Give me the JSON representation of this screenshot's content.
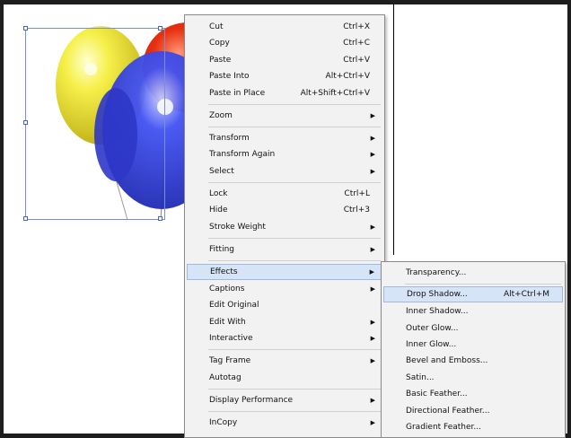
{
  "context_menu": {
    "items": [
      {
        "label": "Cut",
        "shortcut": "Ctrl+X"
      },
      {
        "label": "Copy",
        "shortcut": "Ctrl+C"
      },
      {
        "label": "Paste",
        "shortcut": "Ctrl+V"
      },
      {
        "label": "Paste Into",
        "shortcut": "Alt+Ctrl+V"
      },
      {
        "label": "Paste in Place",
        "shortcut": "Alt+Shift+Ctrl+V"
      },
      {
        "label": "Zoom"
      },
      {
        "label": "Transform"
      },
      {
        "label": "Transform Again"
      },
      {
        "label": "Select"
      },
      {
        "label": "Lock",
        "shortcut": "Ctrl+L"
      },
      {
        "label": "Hide",
        "shortcut": "Ctrl+3"
      },
      {
        "label": "Stroke Weight"
      },
      {
        "label": "Fitting"
      },
      {
        "label": "Effects"
      },
      {
        "label": "Captions"
      },
      {
        "label": "Edit Original"
      },
      {
        "label": "Edit With"
      },
      {
        "label": "Interactive"
      },
      {
        "label": "Tag Frame"
      },
      {
        "label": "Autotag"
      },
      {
        "label": "Display Performance"
      },
      {
        "label": "InCopy"
      }
    ]
  },
  "effects_submenu": {
    "items": [
      {
        "label": "Transparency..."
      },
      {
        "label": "Drop Shadow...",
        "shortcut": "Alt+Ctrl+M"
      },
      {
        "label": "Inner Shadow..."
      },
      {
        "label": "Outer Glow..."
      },
      {
        "label": "Inner Glow..."
      },
      {
        "label": "Bevel and Emboss..."
      },
      {
        "label": "Satin..."
      },
      {
        "label": "Basic Feather..."
      },
      {
        "label": "Directional Feather..."
      },
      {
        "label": "Gradient Feather..."
      }
    ]
  },
  "colors": {
    "highlight": "#d6e4f7",
    "menu_bg": "#f2f2f2",
    "balloon_yellow": "#f2ec3c",
    "balloon_red": "#e02a12",
    "balloon_blue": "#2f3ee6"
  }
}
